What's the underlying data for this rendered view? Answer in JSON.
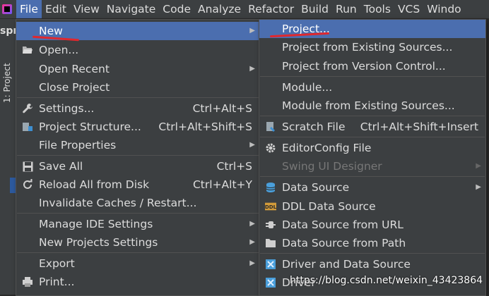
{
  "menubar": {
    "items": [
      "File",
      "Edit",
      "View",
      "Navigate",
      "Code",
      "Analyze",
      "Refactor",
      "Build",
      "Run",
      "Tools",
      "VCS",
      "Windo"
    ]
  },
  "left": {
    "title": "spr",
    "project_tab": "1: Project"
  },
  "file_menu": {
    "new": "New",
    "open": "Open...",
    "open_recent": "Open Recent",
    "close_project": "Close Project",
    "settings": "Settings...",
    "settings_sc": "Ctrl+Alt+S",
    "project_structure": "Project Structure...",
    "project_structure_sc": "Ctrl+Alt+Shift+S",
    "file_properties": "File Properties",
    "save_all": "Save All",
    "save_all_sc": "Ctrl+S",
    "reload": "Reload All from Disk",
    "reload_sc": "Ctrl+Alt+Y",
    "invalidate": "Invalidate Caches / Restart...",
    "manage_ide": "Manage IDE Settings",
    "new_projects_settings": "New Projects Settings",
    "export": "Export",
    "print": "Print..."
  },
  "new_menu": {
    "project": "Project...",
    "project_existing": "Project from Existing Sources...",
    "project_vcs": "Project from Version Control...",
    "module": "Module...",
    "module_existing": "Module from Existing Sources...",
    "scratch": "Scratch File",
    "scratch_sc": "Ctrl+Alt+Shift+Insert",
    "editorconfig": "EditorConfig File",
    "swing": "Swing UI Designer",
    "data_source": "Data Source",
    "ddl": "DDL Data Source",
    "ds_url": "Data Source from URL",
    "ds_path": "Data Source from Path",
    "driver_ds": "Driver and Data Source",
    "driver": "Driver"
  },
  "watermark": "https://blog.csdn.net/weixin_43423864",
  "colors": {
    "selection": "#4b6eaf",
    "menu_bg": "#3c3f41",
    "annotation": "#e0282e"
  }
}
